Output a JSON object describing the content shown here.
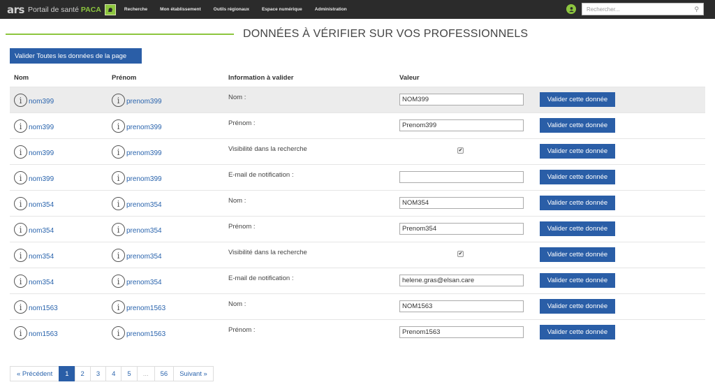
{
  "navbar": {
    "logo_text": "ars",
    "brand_text": "Portail de santé",
    "brand_region": "PACA",
    "menu": [
      "Recherche",
      "Mon établissement",
      "Outils régionaux",
      "Espace numérique",
      "Administration"
    ],
    "search_placeholder": "Rechercher...",
    "accent_color": "#8dc63f"
  },
  "page": {
    "title": "DONNÉES À VÉRIFIER SUR VOS PROFESSIONNELS",
    "validate_all_label": "Valider Toutes les données de la page"
  },
  "table": {
    "headers": {
      "nom": "Nom",
      "prenom": "Prénom",
      "information": "Information à valider",
      "valeur": "Valeur"
    },
    "validate_label": "Valider cette donnée",
    "rows": [
      {
        "nom": "nom399",
        "prenom": "prenom399",
        "field": "Nom :",
        "type": "text",
        "value": "NOM399"
      },
      {
        "nom": "nom399",
        "prenom": "prenom399",
        "field": "Prénom :",
        "type": "text",
        "value": "Prenom399"
      },
      {
        "nom": "nom399",
        "prenom": "prenom399",
        "field": "Visibilité dans la recherche",
        "type": "checkbox",
        "checked": true
      },
      {
        "nom": "nom399",
        "prenom": "prenom399",
        "field": "E-mail de notification :",
        "type": "text",
        "value": ""
      },
      {
        "nom": "nom354",
        "prenom": "prenom354",
        "field": "Nom :",
        "type": "text",
        "value": "NOM354"
      },
      {
        "nom": "nom354",
        "prenom": "prenom354",
        "field": "Prénom :",
        "type": "text",
        "value": "Prenom354"
      },
      {
        "nom": "nom354",
        "prenom": "prenom354",
        "field": "Visibilité dans la recherche",
        "type": "checkbox",
        "checked": true
      },
      {
        "nom": "nom354",
        "prenom": "prenom354",
        "field": "E-mail de notification :",
        "type": "text",
        "value": "helene.gras@elsan.care"
      },
      {
        "nom": "nom1563",
        "prenom": "prenom1563",
        "field": "Nom :",
        "type": "text",
        "value": "NOM1563"
      },
      {
        "nom": "nom1563",
        "prenom": "prenom1563",
        "field": "Prénom :",
        "type": "text",
        "value": "Prenom1563"
      }
    ]
  },
  "pagination": {
    "prev": "« Précédent",
    "pages": [
      "1",
      "2",
      "3",
      "4",
      "5",
      "...",
      "56"
    ],
    "active": "1",
    "next": "Suivant »"
  },
  "colors": {
    "primary": "#2a5ea7",
    "link": "#2a64ad",
    "navbar_bg": "#2b2b2b"
  }
}
